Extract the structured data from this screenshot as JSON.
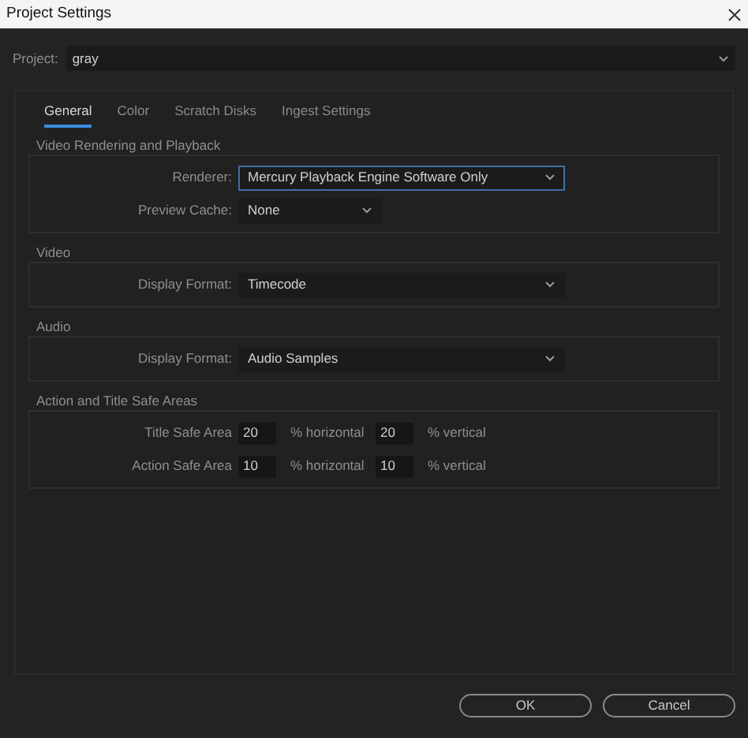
{
  "window": {
    "title": "Project Settings"
  },
  "project": {
    "label": "Project:",
    "value": "gray"
  },
  "tabs": [
    {
      "label": "General",
      "selected": true
    },
    {
      "label": "Color",
      "selected": false
    },
    {
      "label": "Scratch Disks",
      "selected": false
    },
    {
      "label": "Ingest Settings",
      "selected": false
    }
  ],
  "sections": [
    {
      "title": "Video Rendering and Playback",
      "rows": [
        {
          "kind": "dropdown",
          "label": "Renderer:",
          "value": "Mercury Playback Engine Software Only",
          "focused": true,
          "wide": true
        },
        {
          "kind": "dropdown",
          "label": "Preview Cache:",
          "value": "None",
          "focused": false,
          "wide": false
        }
      ]
    },
    {
      "title": "Video",
      "rows": [
        {
          "kind": "dropdown",
          "label": "Display Format:",
          "value": "Timecode",
          "focused": false,
          "wide": true
        }
      ]
    },
    {
      "title": "Audio",
      "rows": [
        {
          "kind": "dropdown",
          "label": "Display Format:",
          "value": "Audio Samples",
          "focused": false,
          "wide": true
        }
      ]
    },
    {
      "title": "Action and Title Safe Areas",
      "rows": [
        {
          "kind": "safe",
          "label": "Title Safe Area",
          "horizontal": "20",
          "horizontal_label": "% horizontal",
          "vertical": "20",
          "vertical_label": "% vertical"
        },
        {
          "kind": "safe",
          "label": "Action Safe Area",
          "horizontal": "10",
          "horizontal_label": "% horizontal",
          "vertical": "10",
          "vertical_label": "% vertical"
        }
      ]
    }
  ],
  "buttons": [
    {
      "label": "OK"
    },
    {
      "label": "Cancel"
    }
  ]
}
